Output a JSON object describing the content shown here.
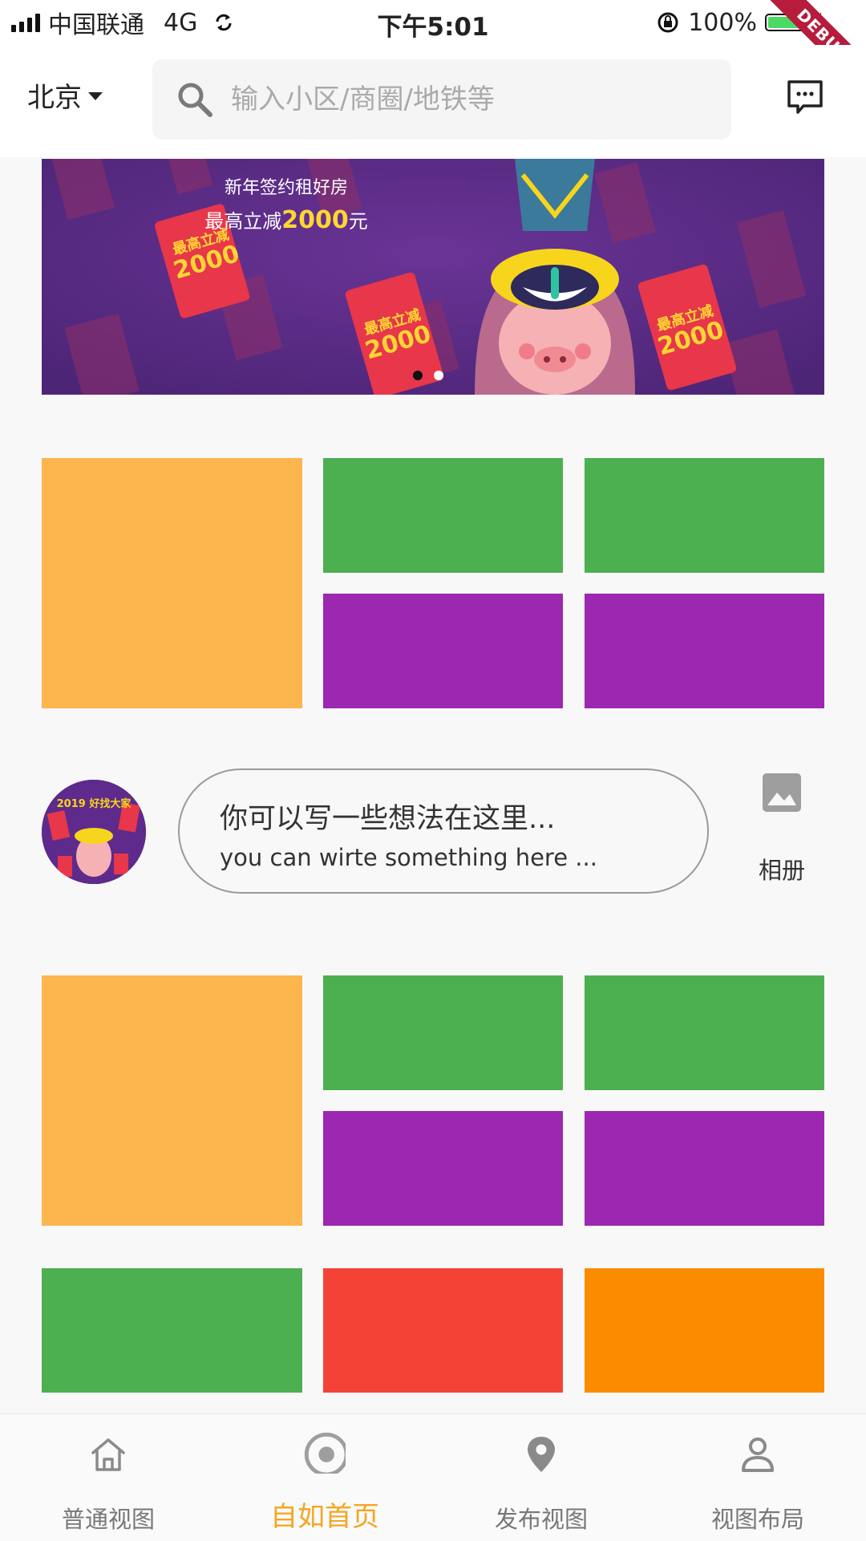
{
  "status_bar": {
    "carrier": "中国联通",
    "network": "4G",
    "time": "下午5:01",
    "battery": "100%",
    "debug_label": "DEBUG"
  },
  "header": {
    "city": "北京",
    "search_placeholder": "输入小区/商圈/地铁等",
    "icons": [
      "search-icon",
      "message-icon"
    ]
  },
  "banner": {
    "line1": "新年签约租好房",
    "line2_prefix": "最高立减",
    "line2_amount": "2000",
    "line2_suffix": "元",
    "envelope_top": "最高立减",
    "envelope_amount": "2000",
    "avatar_text": "2019 好找大家",
    "active_page": 1,
    "page_count": 2
  },
  "post": {
    "prompt_cn": "你可以写一些想法在这里...",
    "prompt_en": "you can wirte something here ...",
    "album_label": "相册",
    "icons": [
      "image-icon"
    ]
  },
  "colors": {
    "tile_orange": "#fdb54e",
    "tile_green": "#4caf50",
    "tile_purple": "#9c27b0",
    "tile_red": "#f44336",
    "tile_deep_orange": "#fb8c00",
    "nav_active": "#f5a623"
  },
  "bottom_nav": {
    "items": [
      {
        "label": "普通视图",
        "icon": "home-icon"
      },
      {
        "label": "自如首页",
        "icon": "radio-target-icon",
        "active": true
      },
      {
        "label": "发布视图",
        "icon": "location-pin-icon"
      },
      {
        "label": "视图布局",
        "icon": "person-icon"
      }
    ]
  }
}
